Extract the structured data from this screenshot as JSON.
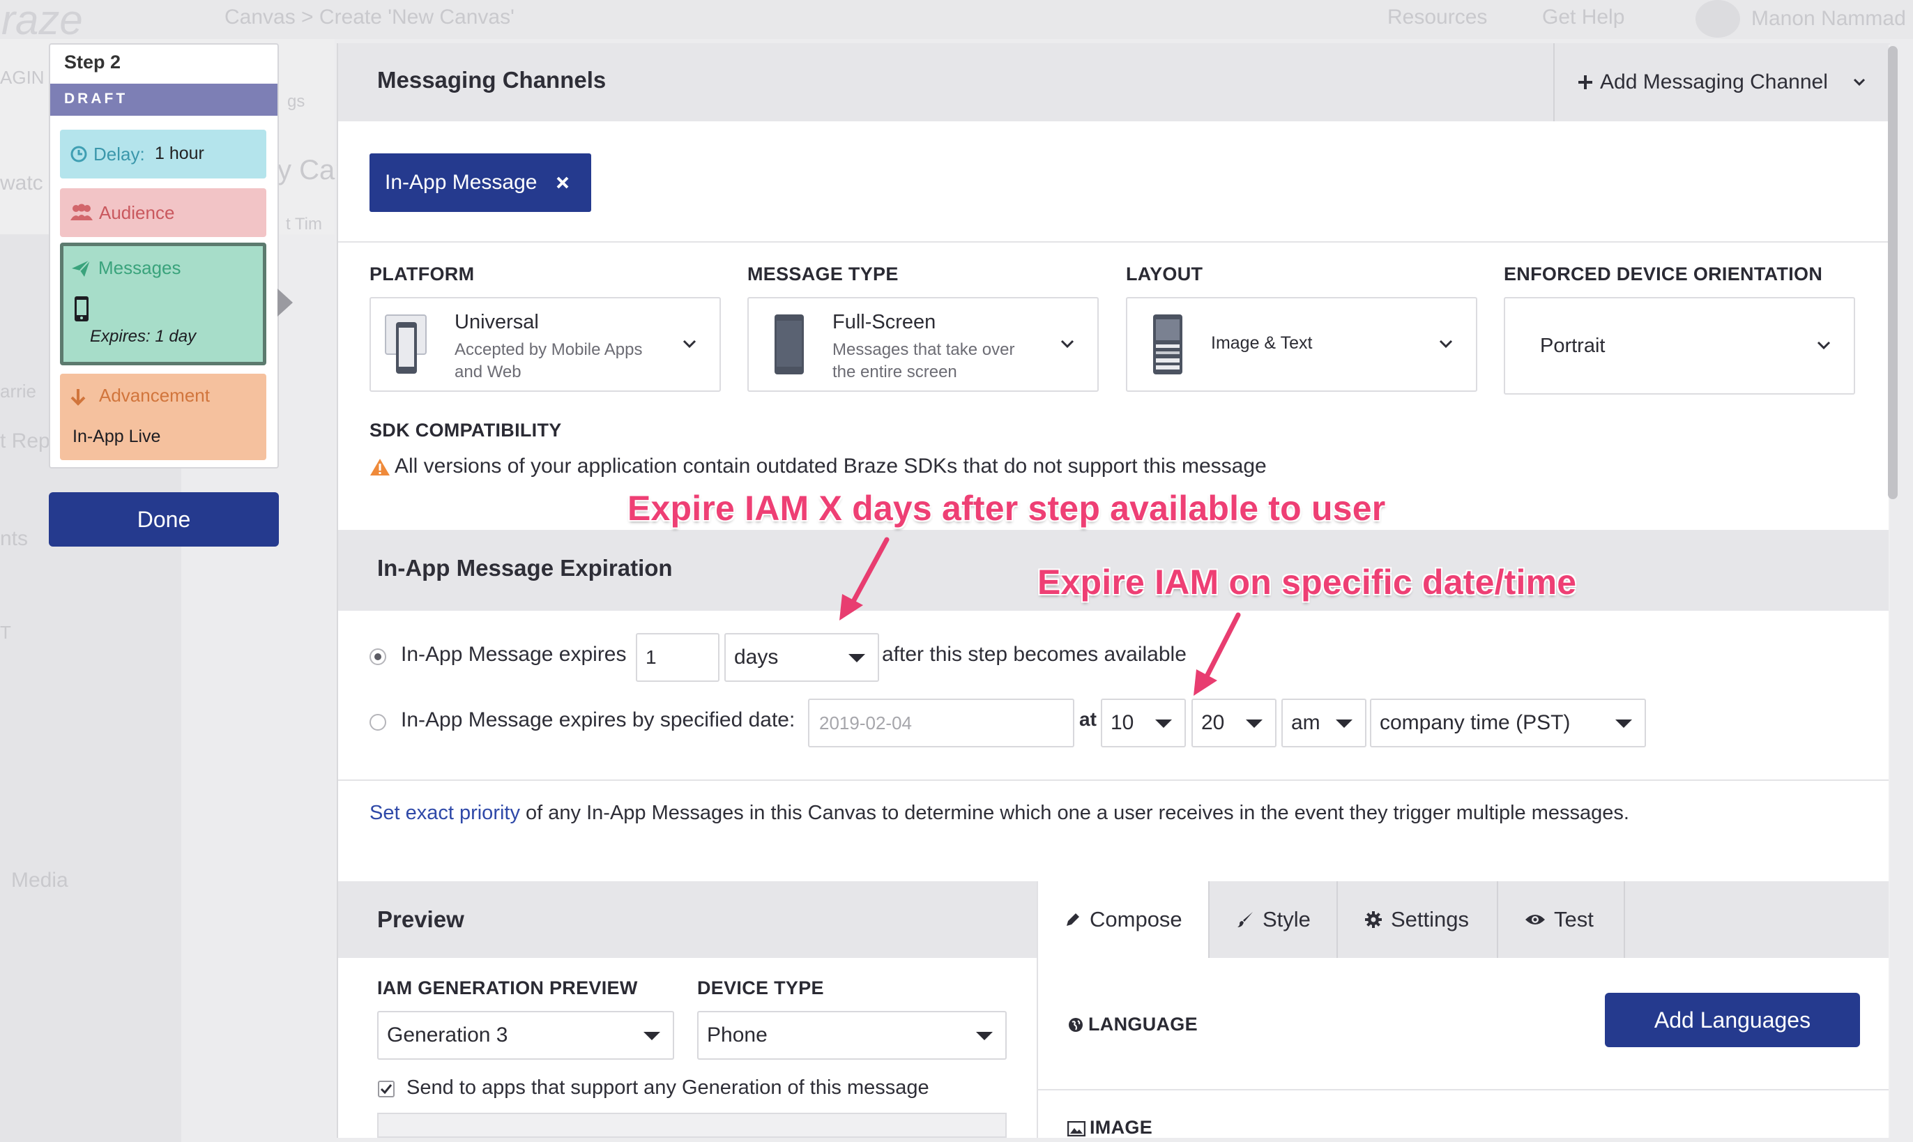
{
  "background": {
    "logo": "raze",
    "breadcrumb": "Canvas > Create 'New Canvas'",
    "nav_resources": "Resources",
    "nav_help": "Get Help",
    "user_name": "Manon Nammad",
    "ghost_texts": [
      "AGIN",
      "gs",
      "watc",
      "y Car",
      "t Tim",
      "arrie",
      "t Rep",
      "nts",
      "T",
      "Media"
    ]
  },
  "step_panel": {
    "title": "Step 2",
    "status": "DRAFT",
    "delay_label": "Delay:",
    "delay_value": "1 hour",
    "audience_label": "Audience",
    "messages_label": "Messages",
    "messages_expires": "Expires: 1 day",
    "advancement_label": "Advancement",
    "advancement_value": "In-App Live",
    "done_label": "Done"
  },
  "modal": {
    "title": "Messaging Channels",
    "add_channel_label": "Add Messaging Channel",
    "channel_chip": "In-App Message",
    "platform": {
      "heading": "PLATFORM",
      "name": "Universal",
      "description": "Accepted by Mobile Apps and Web"
    },
    "message_type": {
      "heading": "MESSAGE TYPE",
      "name": "Full-Screen",
      "description": "Messages that take over the entire screen"
    },
    "layout": {
      "heading": "LAYOUT",
      "name": "Image & Text"
    },
    "orientation": {
      "heading": "ENFORCED DEVICE ORIENTATION",
      "value": "Portrait"
    },
    "sdk": {
      "heading": "SDK COMPATIBILITY",
      "warning": "All versions of your application contain outdated Braze SDKs that do not support this message"
    },
    "expiration": {
      "title": "In-App Message Expiration",
      "option1_label": "In-App Message expires",
      "option1_value": "1",
      "option1_unit": "days",
      "option1_suffix": "after this step becomes available",
      "option2_label": "In-App Message expires by specified date:",
      "option2_date_placeholder": "2019-02-04",
      "at_label": "at",
      "hour": "10",
      "minute": "20",
      "ampm": "am",
      "timezone": "company time (PST)"
    },
    "priority": {
      "link": "Set exact priority",
      "text": "of any In-App Messages in this Canvas to determine which one a user receives in the event they trigger multiple messages."
    },
    "preview": {
      "title": "Preview",
      "generation_heading": "IAM GENERATION PREVIEW",
      "generation_value": "Generation 3",
      "device_heading": "DEVICE TYPE",
      "device_value": "Phone",
      "send_checkbox_label": "Send to apps that support any Generation of this message"
    },
    "tabs": [
      "Compose",
      "Style",
      "Settings",
      "Test"
    ],
    "compose": {
      "language_heading": "LANGUAGE",
      "add_languages_label": "Add Languages",
      "image_heading": "IMAGE"
    }
  },
  "annotations": {
    "expire_days": "Expire IAM X days after step available to user",
    "expire_date": "Expire IAM on specific date/time"
  },
  "colors": {
    "primary": "#253a8e",
    "annotation": "#ee3f74",
    "draft_bar": "#7d7fb5",
    "delay_card": "#b4e4ec",
    "audience_card": "#f2c4c6",
    "messages_card": "#a7ddc9",
    "advancement_card": "#f5c19e"
  }
}
